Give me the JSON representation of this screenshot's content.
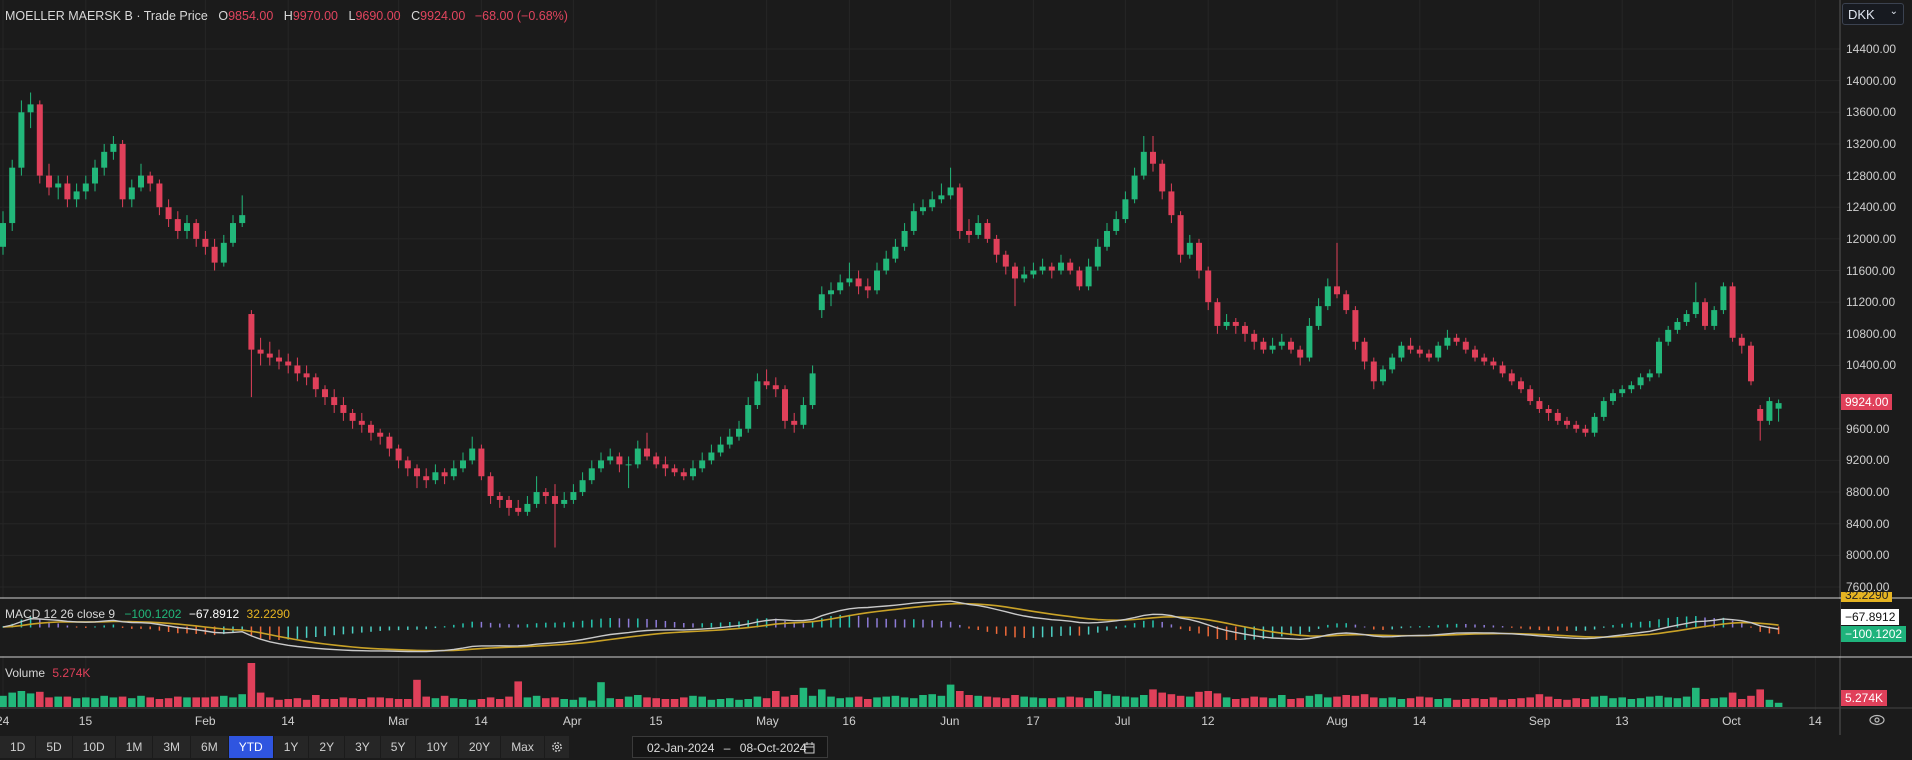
{
  "header": {
    "instrument": "MOELLER MAERSK B",
    "separator": "·",
    "series": "Trade Price",
    "o_label": "O",
    "o": "9854.00",
    "h_label": "H",
    "h": "9970.00",
    "l_label": "L",
    "l": "9690.00",
    "c_label": "C",
    "c": "9924.00",
    "change": "−68.00 (−0.68%)"
  },
  "currency": {
    "value": "DKK",
    "chevron": "⌄"
  },
  "price_axis": [
    "14400.00",
    "14000.00",
    "13600.00",
    "13200.00",
    "12800.00",
    "12400.00",
    "12000.00",
    "11600.00",
    "11200.00",
    "10800.00",
    "10400.00",
    "9600.00",
    "9200.00",
    "8800.00",
    "8400.00",
    "8000.00",
    "7600.00"
  ],
  "last_price_tag": "9924.00",
  "macd": {
    "label": "MACD 12 26 close 9",
    "macd_value": "−100.1202",
    "signal_value": "−67.8912",
    "hist_value": "32.2290",
    "tag_hist": "32.2290",
    "tag_signal": "−67.8912",
    "tag_macd": "−100.1202"
  },
  "volume": {
    "label": "Volume",
    "value": "5.274K",
    "tag": "5.274K"
  },
  "x_axis": [
    {
      "label": "24",
      "date": "2024-01-02"
    },
    {
      "label": "15",
      "date": "2024-01-15"
    },
    {
      "label": "Feb",
      "date": "2024-02-01"
    },
    {
      "label": "14",
      "date": "2024-02-14"
    },
    {
      "label": "Mar",
      "date": "2024-03-01"
    },
    {
      "label": "14",
      "date": "2024-03-14"
    },
    {
      "label": "Apr",
      "date": "2024-04-02"
    },
    {
      "label": "15",
      "date": "2024-04-15"
    },
    {
      "label": "May",
      "date": "2024-05-01"
    },
    {
      "label": "16",
      "date": "2024-05-16"
    },
    {
      "label": "Jun",
      "date": "2024-06-03"
    },
    {
      "label": "17",
      "date": "2024-06-17"
    },
    {
      "label": "Jul",
      "date": "2024-07-01"
    },
    {
      "label": "12",
      "date": "2024-07-12"
    },
    {
      "label": "Aug",
      "date": "2024-08-01"
    },
    {
      "label": "14",
      "date": "2024-08-14"
    },
    {
      "label": "Sep",
      "date": "2024-09-02"
    },
    {
      "label": "13",
      "date": "2024-09-13"
    },
    {
      "label": "Oct",
      "date": "2024-10-01"
    },
    {
      "label": "14",
      "date": "2024-10-14"
    }
  ],
  "toolbar": {
    "ranges": [
      "1D",
      "5D",
      "10D",
      "1M",
      "3M",
      "6M",
      "YTD",
      "1Y",
      "2Y",
      "3Y",
      "5Y",
      "10Y",
      "20Y",
      "Max"
    ],
    "active": "YTD",
    "date_from": "02-Jan-2024",
    "date_sep": "–",
    "date_to": "08-Oct-2024"
  },
  "colors": {
    "up": "#22b77a",
    "down": "#e0405a",
    "macd_line": "#c9c9c9",
    "signal_line": "#c9a227",
    "background": "#1b1b1b",
    "accent": "#2f55e0"
  },
  "chart_data": {
    "type": "candlestick",
    "start_date": "2024-01-02",
    "end_date": "2024-10-08",
    "ylim": [
      7600,
      14400
    ],
    "ohlc": [
      [
        11900,
        12350,
        11800,
        12200
      ],
      [
        12200,
        13000,
        12100,
        12900
      ],
      [
        12900,
        13750,
        12800,
        13600
      ],
      [
        13600,
        13850,
        13400,
        13700
      ],
      [
        13700,
        13750,
        12700,
        12800
      ],
      [
        12800,
        12950,
        12550,
        12650
      ],
      [
        12650,
        12800,
        12500,
        12700
      ],
      [
        12700,
        12800,
        12400,
        12500
      ],
      [
        12500,
        12700,
        12400,
        12600
      ],
      [
        12600,
        12800,
        12500,
        12700
      ],
      [
        12700,
        13000,
        12600,
        12900
      ],
      [
        12900,
        13200,
        12800,
        13100
      ],
      [
        13100,
        13300,
        13000,
        13200
      ],
      [
        13200,
        13250,
        12400,
        12500
      ],
      [
        12500,
        12750,
        12400,
        12650
      ],
      [
        12650,
        12950,
        12600,
        12800
      ],
      [
        12800,
        12850,
        12600,
        12700
      ],
      [
        12700,
        12750,
        12300,
        12400
      ],
      [
        12400,
        12500,
        12150,
        12250
      ],
      [
        12250,
        12350,
        12000,
        12100
      ],
      [
        12100,
        12300,
        12000,
        12200
      ],
      [
        12200,
        12250,
        11900,
        12000
      ],
      [
        12000,
        12100,
        11800,
        11900
      ],
      [
        11900,
        12000,
        11600,
        11700
      ],
      [
        11700,
        12050,
        11650,
        11950
      ],
      [
        11950,
        12300,
        11900,
        12200
      ],
      [
        12200,
        12550,
        12150,
        12300
      ],
      [
        11050,
        11100,
        10000,
        10600
      ],
      [
        10600,
        10750,
        10400,
        10550
      ],
      [
        10550,
        10700,
        10400,
        10500
      ],
      [
        10500,
        10600,
        10350,
        10450
      ],
      [
        10450,
        10550,
        10300,
        10400
      ],
      [
        10400,
        10500,
        10200,
        10300
      ],
      [
        10300,
        10400,
        10150,
        10250
      ],
      [
        10250,
        10300,
        10000,
        10100
      ],
      [
        10100,
        10150,
        9900,
        10000
      ],
      [
        10000,
        10100,
        9800,
        9900
      ],
      [
        9900,
        10000,
        9700,
        9800
      ],
      [
        9800,
        9850,
        9600,
        9700
      ],
      [
        9700,
        9800,
        9550,
        9650
      ],
      [
        9650,
        9700,
        9450,
        9550
      ],
      [
        9550,
        9600,
        9400,
        9500
      ],
      [
        9500,
        9550,
        9250,
        9350
      ],
      [
        9350,
        9400,
        9100,
        9200
      ],
      [
        9200,
        9250,
        9000,
        9100
      ],
      [
        9100,
        9150,
        8850,
        9000
      ],
      [
        9000,
        9100,
        8850,
        8950
      ],
      [
        8950,
        9150,
        8900,
        9050
      ],
      [
        9050,
        9100,
        8900,
        9000
      ],
      [
        9000,
        9200,
        8950,
        9100
      ],
      [
        9100,
        9300,
        9050,
        9200
      ],
      [
        9200,
        9500,
        9150,
        9350
      ],
      [
        9350,
        9400,
        8950,
        9000
      ],
      [
        9000,
        9050,
        8650,
        8750
      ],
      [
        8750,
        8800,
        8600,
        8700
      ],
      [
        8700,
        8750,
        8500,
        8600
      ],
      [
        8600,
        8700,
        8500,
        8550
      ],
      [
        8550,
        8750,
        8500,
        8650
      ],
      [
        8650,
        9000,
        8600,
        8800
      ],
      [
        8800,
        8850,
        8650,
        8750
      ],
      [
        8750,
        8900,
        8100,
        8650
      ],
      [
        8650,
        8800,
        8600,
        8700
      ],
      [
        8700,
        8900,
        8650,
        8800
      ],
      [
        8800,
        9050,
        8750,
        8950
      ],
      [
        8950,
        9200,
        8900,
        9100
      ],
      [
        9100,
        9300,
        9050,
        9200
      ],
      [
        9200,
        9350,
        9150,
        9250
      ],
      [
        9250,
        9300,
        9050,
        9150
      ],
      [
        9150,
        9250,
        8850,
        9150
      ],
      [
        9150,
        9450,
        9100,
        9350
      ],
      [
        9350,
        9550,
        9200,
        9250
      ],
      [
        9250,
        9300,
        9100,
        9150
      ],
      [
        9150,
        9250,
        9000,
        9100
      ],
      [
        9100,
        9150,
        9000,
        9050
      ],
      [
        9050,
        9100,
        8950,
        9000
      ],
      [
        9000,
        9200,
        8950,
        9100
      ],
      [
        9100,
        9300,
        9050,
        9200
      ],
      [
        9200,
        9400,
        9150,
        9300
      ],
      [
        9300,
        9500,
        9250,
        9400
      ],
      [
        9400,
        9600,
        9350,
        9500
      ],
      [
        9500,
        9700,
        9450,
        9600
      ],
      [
        9600,
        10000,
        9550,
        9900
      ],
      [
        9900,
        10300,
        9850,
        10200
      ],
      [
        10200,
        10350,
        10100,
        10150
      ],
      [
        10150,
        10250,
        10000,
        10100
      ],
      [
        10100,
        10150,
        9600,
        9700
      ],
      [
        9700,
        9800,
        9550,
        9650
      ],
      [
        9650,
        10000,
        9600,
        9900
      ],
      [
        9900,
        10400,
        9850,
        10300
      ],
      [
        11100,
        11400,
        11000,
        11300
      ],
      [
        11300,
        11450,
        11150,
        11350
      ],
      [
        11350,
        11550,
        11300,
        11450
      ],
      [
        11450,
        11700,
        11400,
        11500
      ],
      [
        11500,
        11600,
        11300,
        11400
      ],
      [
        11400,
        11500,
        11250,
        11350
      ],
      [
        11350,
        11700,
        11300,
        11600
      ],
      [
        11600,
        11850,
        11550,
        11750
      ],
      [
        11750,
        12000,
        11700,
        11900
      ],
      [
        11900,
        12200,
        11850,
        12100
      ],
      [
        12100,
        12450,
        12050,
        12350
      ],
      [
        12350,
        12500,
        12300,
        12400
      ],
      [
        12400,
        12600,
        12350,
        12500
      ],
      [
        12500,
        12700,
        12450,
        12550
      ],
      [
        12550,
        12900,
        12500,
        12650
      ],
      [
        12650,
        12700,
        12000,
        12100
      ],
      [
        12100,
        12250,
        11950,
        12050
      ],
      [
        12050,
        12300,
        12000,
        12200
      ],
      [
        12200,
        12250,
        11950,
        12000
      ],
      [
        12000,
        12050,
        11700,
        11800
      ],
      [
        11800,
        11850,
        11550,
        11650
      ],
      [
        11650,
        11700,
        11150,
        11500
      ],
      [
        11500,
        11650,
        11450,
        11550
      ],
      [
        11550,
        11700,
        11500,
        11600
      ],
      [
        11600,
        11750,
        11550,
        11650
      ],
      [
        11650,
        11700,
        11500,
        11600
      ],
      [
        11600,
        11800,
        11550,
        11700
      ],
      [
        11700,
        11750,
        11550,
        11600
      ],
      [
        11600,
        11650,
        11350,
        11400
      ],
      [
        11400,
        11750,
        11350,
        11650
      ],
      [
        11650,
        12000,
        11600,
        11900
      ],
      [
        11900,
        12200,
        11850,
        12100
      ],
      [
        12100,
        12350,
        12050,
        12250
      ],
      [
        12250,
        12600,
        12200,
        12500
      ],
      [
        12500,
        12900,
        12450,
        12800
      ],
      [
        12800,
        13300,
        12750,
        13100
      ],
      [
        13100,
        13300,
        12850,
        12950
      ],
      [
        12950,
        13000,
        12500,
        12600
      ],
      [
        12600,
        12700,
        12200,
        12300
      ],
      [
        12300,
        12350,
        11700,
        11800
      ],
      [
        11800,
        12050,
        11750,
        11950
      ],
      [
        11950,
        12000,
        11500,
        11600
      ],
      [
        11600,
        11650,
        11100,
        11200
      ],
      [
        11200,
        11250,
        10800,
        10900
      ],
      [
        10900,
        11050,
        10850,
        10950
      ],
      [
        10950,
        11000,
        10800,
        10900
      ],
      [
        10900,
        10950,
        10700,
        10800
      ],
      [
        10800,
        10850,
        10600,
        10700
      ],
      [
        10700,
        10750,
        10550,
        10600
      ],
      [
        10600,
        10750,
        10550,
        10650
      ],
      [
        10650,
        10800,
        10600,
        10700
      ],
      [
        10700,
        10750,
        10550,
        10600
      ],
      [
        10600,
        10650,
        10400,
        10500
      ],
      [
        10500,
        11000,
        10450,
        10900
      ],
      [
        10900,
        11250,
        10850,
        11150
      ],
      [
        11150,
        11500,
        11100,
        11400
      ],
      [
        11400,
        11950,
        11250,
        11300
      ],
      [
        11300,
        11350,
        11050,
        11100
      ],
      [
        11100,
        11150,
        10600,
        10700
      ],
      [
        10700,
        10750,
        10350,
        10450
      ],
      [
        10450,
        10500,
        10100,
        10200
      ],
      [
        10200,
        10400,
        10150,
        10350
      ],
      [
        10350,
        10550,
        10300,
        10500
      ],
      [
        10500,
        10700,
        10450,
        10650
      ],
      [
        10650,
        10750,
        10550,
        10600
      ],
      [
        10600,
        10650,
        10500,
        10550
      ],
      [
        10550,
        10600,
        10450,
        10500
      ],
      [
        10500,
        10700,
        10450,
        10650
      ],
      [
        10650,
        10850,
        10600,
        10750
      ],
      [
        10750,
        10800,
        10650,
        10700
      ],
      [
        10700,
        10750,
        10550,
        10600
      ],
      [
        10600,
        10650,
        10450,
        10500
      ],
      [
        10500,
        10550,
        10400,
        10450
      ],
      [
        10450,
        10500,
        10350,
        10400
      ],
      [
        10400,
        10450,
        10250,
        10300
      ],
      [
        10300,
        10350,
        10150,
        10200
      ],
      [
        10200,
        10250,
        10050,
        10100
      ],
      [
        10100,
        10150,
        9900,
        9950
      ],
      [
        9950,
        10000,
        9800,
        9850
      ],
      [
        9850,
        9900,
        9700,
        9800
      ],
      [
        9800,
        9850,
        9650,
        9700
      ],
      [
        9700,
        9750,
        9600,
        9650
      ],
      [
        9650,
        9700,
        9550,
        9600
      ],
      [
        9600,
        9650,
        9500,
        9550
      ],
      [
        9550,
        9800,
        9500,
        9750
      ],
      [
        9750,
        10000,
        9700,
        9950
      ],
      [
        9950,
        10100,
        9900,
        10050
      ],
      [
        10050,
        10150,
        10000,
        10100
      ],
      [
        10100,
        10200,
        10050,
        10150
      ],
      [
        10150,
        10300,
        10100,
        10250
      ],
      [
        10250,
        10350,
        10200,
        10300
      ],
      [
        10300,
        10750,
        10250,
        10700
      ],
      [
        10700,
        10900,
        10650,
        10850
      ],
      [
        10850,
        11000,
        10800,
        10950
      ],
      [
        10950,
        11100,
        10900,
        11050
      ],
      [
        11050,
        11450,
        11000,
        11200
      ],
      [
        11200,
        11250,
        10850,
        10900
      ],
      [
        10900,
        11150,
        10850,
        11100
      ],
      [
        11100,
        11450,
        11050,
        11400
      ],
      [
        11400,
        11450,
        10700,
        10750
      ],
      [
        10750,
        10800,
        10550,
        10650
      ],
      [
        10650,
        10700,
        10150,
        10200
      ],
      [
        9850,
        9900,
        9450,
        9700
      ],
      [
        9700,
        10000,
        9650,
        9950
      ],
      [
        9854,
        9970,
        9690,
        9924
      ]
    ],
    "volume_k": [
      14,
      18,
      20,
      17,
      19,
      12,
      13,
      13,
      11,
      12,
      11,
      14,
      12,
      13,
      11,
      14,
      12,
      10,
      11,
      13,
      12,
      12,
      12,
      13,
      14,
      12,
      16,
      55,
      18,
      12,
      9,
      10,
      11,
      9,
      15,
      10,
      10,
      12,
      11,
      10,
      12,
      12,
      11,
      10,
      10,
      34,
      13,
      11,
      14,
      11,
      10,
      9,
      10,
      12,
      10,
      13,
      32,
      12,
      14,
      11,
      12,
      10,
      9,
      12,
      8,
      31,
      11,
      10,
      13,
      15,
      12,
      11,
      10,
      10,
      12,
      14,
      13,
      9,
      10,
      11,
      9,
      10,
      13,
      11,
      20,
      13,
      15,
      24,
      14,
      22,
      13,
      11,
      12,
      13,
      10,
      12,
      13,
      14,
      12,
      11,
      15,
      16,
      14,
      28,
      20,
      15,
      14,
      13,
      12,
      11,
      15,
      13,
      12,
      11,
      11,
      12,
      13,
      12,
      11,
      20,
      16,
      14,
      13,
      12,
      15,
      22,
      18,
      16,
      14,
      13,
      19,
      20,
      17,
      12,
      10,
      11,
      13,
      12,
      11,
      15,
      10,
      11,
      14,
      16,
      12,
      13,
      15,
      14,
      16,
      12,
      11,
      12,
      10,
      11,
      13,
      12,
      10,
      11,
      9,
      10,
      11,
      10,
      12,
      9,
      10,
      11,
      12,
      16,
      13,
      10,
      9,
      11,
      10,
      13,
      14,
      11,
      12,
      10,
      11,
      13,
      14,
      12,
      11,
      13,
      24,
      10,
      11,
      12,
      18,
      10,
      14,
      22,
      9,
      5.274
    ],
    "macd_params": {
      "fast": 12,
      "slow": 26,
      "signal": 9,
      "source": "close"
    }
  }
}
